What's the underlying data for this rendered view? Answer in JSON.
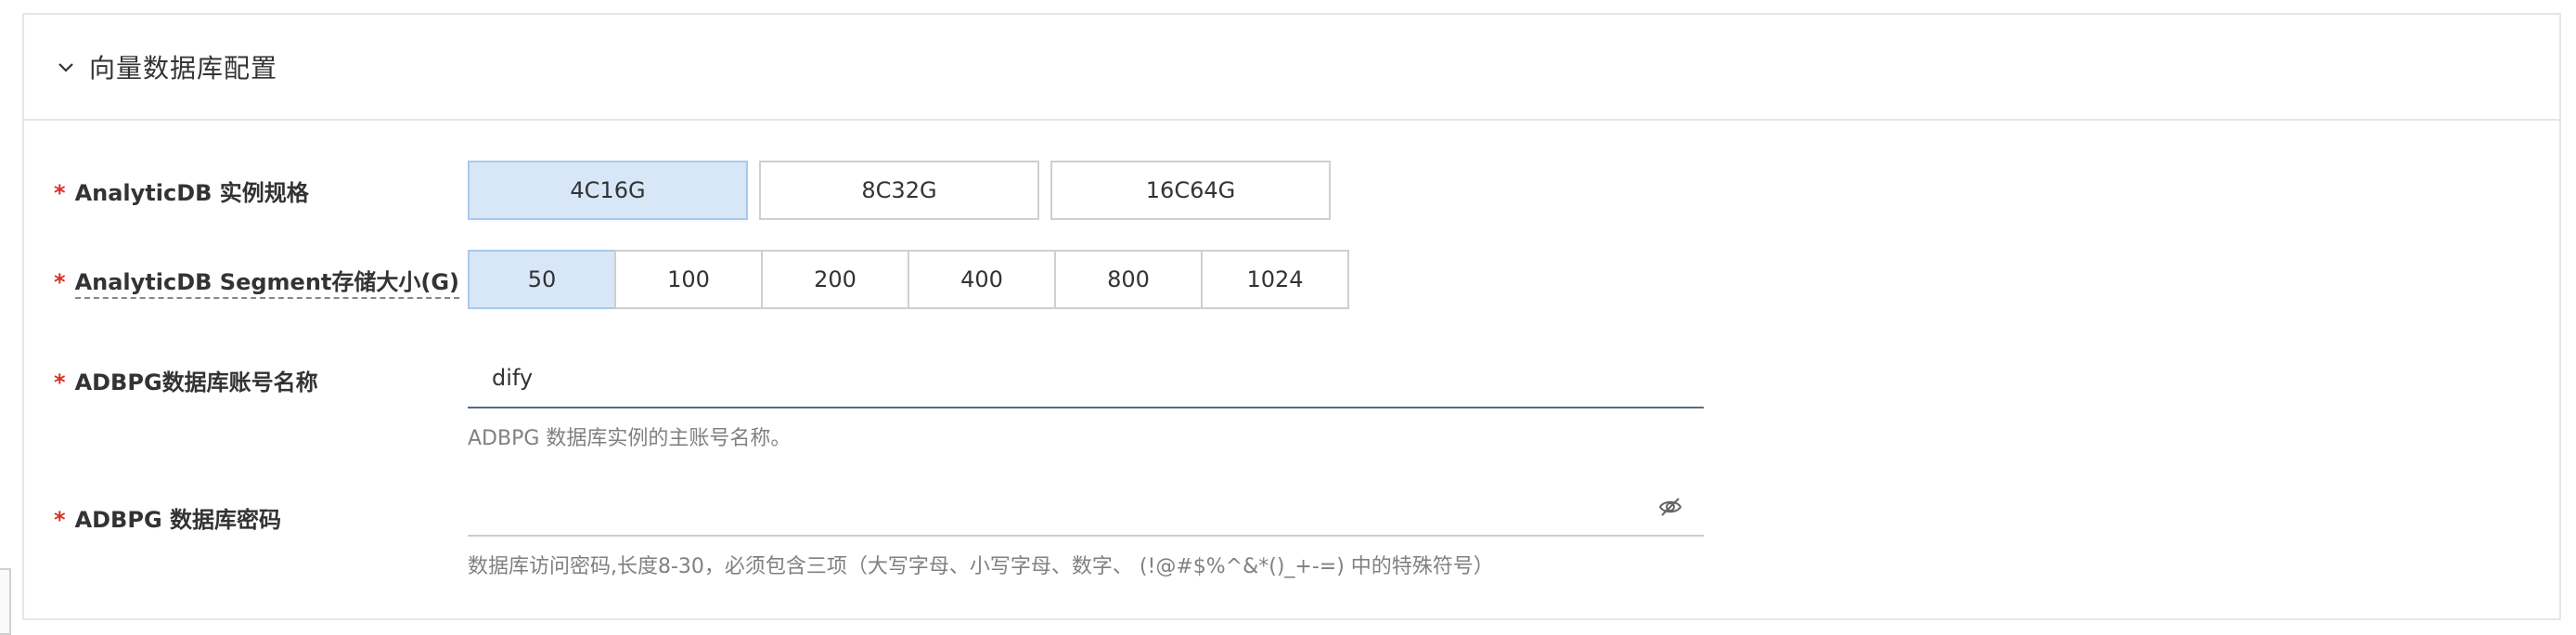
{
  "section": {
    "title": "向量数据库配置",
    "toggle_icon": "chevron-down-icon"
  },
  "spec": {
    "required_mark": "*",
    "label": "AnalyticDB 实例规格",
    "options": [
      "4C16G",
      "8C32G",
      "16C64G"
    ],
    "selected": "4C16G"
  },
  "storage": {
    "required_mark": "*",
    "label": "AnalyticDB Segment存储大小(G)",
    "options": [
      "50",
      "100",
      "200",
      "400",
      "800",
      "1024"
    ],
    "selected": "50"
  },
  "account": {
    "required_mark": "*",
    "label": "ADBPG数据库账号名称",
    "value": "dify",
    "help": "ADBPG 数据库实例的主账号名称。"
  },
  "password": {
    "required_mark": "*",
    "label": "ADBPG 数据库密码",
    "value": "",
    "help": "数据库访问密码,长度8-30，必须包含三项（大写字母、小写字母、数字、 (!@#$%^&*()_+-=) 中的特殊符号）",
    "toggle_icon": "eye-slash-icon"
  },
  "colors": {
    "selected_bg": "#d7e7f8",
    "required": "#d93026",
    "border": "#cfcfcf"
  }
}
